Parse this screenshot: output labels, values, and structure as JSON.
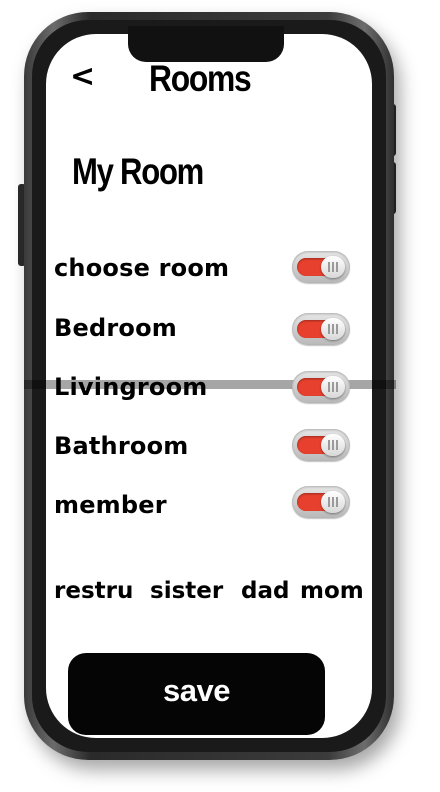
{
  "header": {
    "back_label": "<",
    "title": "Rooms"
  },
  "section": {
    "title": "My Room"
  },
  "rows": [
    {
      "label": "choose room",
      "toggle_on": true
    },
    {
      "label": "Bedroom",
      "toggle_on": true
    },
    {
      "label": "Livingroom",
      "toggle_on": true
    },
    {
      "label": "Bathroom",
      "toggle_on": true
    },
    {
      "label": "member",
      "toggle_on": true
    }
  ],
  "members": [
    "restru",
    "sister",
    "dad",
    "mom"
  ],
  "footer": {
    "save_label": "save"
  },
  "colors": {
    "toggle_on": "#e8402e",
    "button_bg": "#050505",
    "button_text": "#ffffff"
  }
}
